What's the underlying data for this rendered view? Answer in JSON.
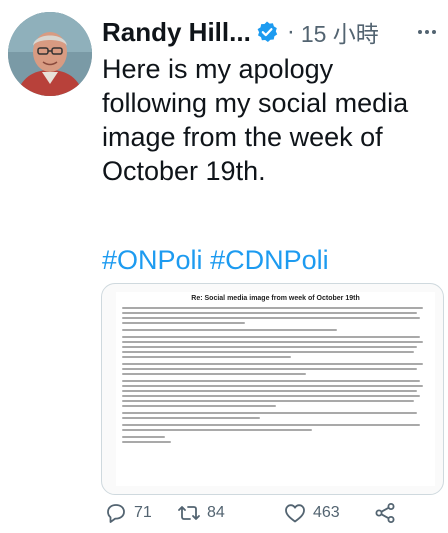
{
  "author": {
    "display_name": "Randy Hill...",
    "verified": true
  },
  "timestamp": "15 小時",
  "separator": "·",
  "tweet": {
    "text": "Here is my apology\nfollowing my social media\nimage from the week of\nOctober 19th.",
    "hashtags": [
      "#ONPoli",
      "#CDNPoli"
    ]
  },
  "media": {
    "doc_title": "Re: Social media image from week of October 19th"
  },
  "actions": {
    "reply_count": "71",
    "retweet_count": "84",
    "like_count": "463"
  },
  "colors": {
    "link": "#1d9bf0",
    "muted": "#536471",
    "text": "#0f1419"
  }
}
